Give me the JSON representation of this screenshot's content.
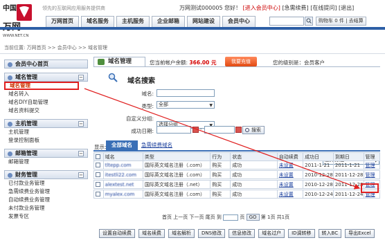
{
  "header": {
    "logo_cn": "中国",
    "logo_big": "万网",
    "logo_url": "WWW.NET.CN",
    "slogan": "领先的互联网应用服务提供商",
    "user_bar": "万网测试000005 您好！",
    "user_links": [
      "[进入会员中心]",
      "[急需续费]",
      "[在线提问]",
      "[退出]"
    ],
    "nav_tabs": [
      "万网首页",
      "域名服务",
      "主机服务",
      "企业邮箱",
      "网站建设",
      "会员中心"
    ],
    "cart": "购物车 0 件 | 去结算"
  },
  "breadcrumb": "当前位置: 万网首页 >> 会员中心 >> 域名管理",
  "sidebar": {
    "home": "会员中心首页",
    "sections": [
      {
        "title": "域名管理",
        "items": [
          "域名管理",
          "域名转入",
          "域名DIY自助管理",
          "域名资料提交"
        ]
      },
      {
        "title": "主机管理",
        "items": [
          "主机管理",
          "登录控制面板"
        ]
      },
      {
        "title": "邮箱管理",
        "items": [
          "邮箱管理"
        ]
      },
      {
        "title": "财务管理",
        "items": [
          "已付款业务管理",
          "急需续费业务管理",
          "自动续费业务管理",
          "未付款业务管理",
          "发票专区"
        ]
      }
    ]
  },
  "main": {
    "tab_title": "域名管理",
    "balance_label": "您当前帐户余额:",
    "balance_value": "366.00 元",
    "recharge": "我要充值",
    "level": "您的级别是：会员客户"
  },
  "search": {
    "title": "域名搜索",
    "domain_label": "域名:",
    "type_label": "类型:",
    "type_value": "全部",
    "group_label": "自定义分组:",
    "group_value": "选择分组",
    "time_label": "成功日期:",
    "time_sep": "-",
    "button": "搜索"
  },
  "list": {
    "show_label": "显示:",
    "tab_all": "全部域名",
    "tab_urgent": "急需续费域名",
    "group_select": "选择分组",
    "columns": [
      "域名",
      "类型",
      "行为",
      "状态",
      "自动续费",
      "成功日",
      "到期日",
      "管理"
    ],
    "rows": [
      {
        "domain": "tltepp.com",
        "type": "国际英文域名注册（.com）",
        "action": "购买",
        "status": "成功",
        "auto": "未设置",
        "start": "2011-1-21",
        "end": "2011-1-21",
        "manage": "管理"
      },
      {
        "domain": "itestli22.com",
        "type": "国际英文域名注册（.com）",
        "action": "购买",
        "status": "成功",
        "auto": "未设置",
        "start": "2010-12-28",
        "end": "2011-12-28",
        "manage": "管理"
      },
      {
        "domain": "alextest.net",
        "type": "国际英文域名注册（.net）",
        "action": "购买",
        "status": "成功",
        "auto": "未设置",
        "start": "2010-12-28",
        "end": "2011-12-28",
        "manage": "管理"
      },
      {
        "domain": "myalex.com",
        "type": "国际英文域名注册（.com）",
        "action": "购买",
        "status": "成功",
        "auto": "未设置",
        "start": "2010-12-24",
        "end": "2011-12-24",
        "manage": "管理"
      }
    ]
  },
  "pager": {
    "text_before": "首页 上一页 下一页 尾页 到",
    "text_page": "页",
    "go": "GO",
    "text_after": "第 1页 共1页"
  },
  "actions": [
    "设置自动续费",
    "域名续费",
    "域名解析",
    "DNS修改",
    "信息修改",
    "域名过户",
    "ID调转移",
    "转入BC",
    "导出Excel"
  ],
  "colors": {
    "brand_blue": "#2d5fa6",
    "highlight_red": "#e02020",
    "link_blue": "#1a3f9c"
  }
}
